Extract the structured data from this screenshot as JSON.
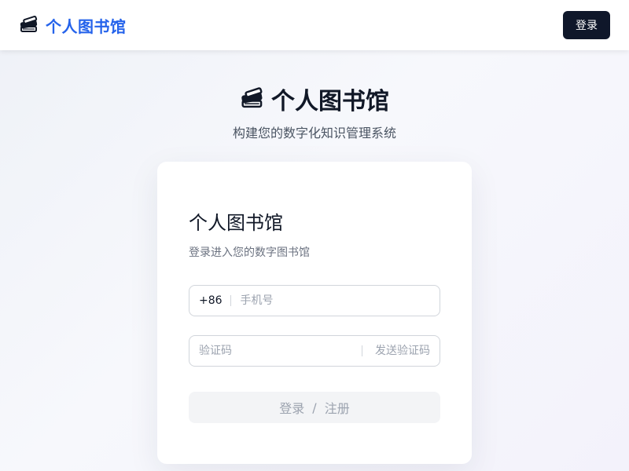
{
  "colors": {
    "brand": "#2563eb",
    "primary_button_bg": "#0f172a",
    "disabled_button_bg": "#f3f4f6"
  },
  "header": {
    "icon": "books-icon",
    "brand_name": "个人图书馆",
    "login_button": "登录"
  },
  "hero": {
    "icon": "books-icon",
    "title": "个人图书馆",
    "subtitle": "构建您的数字化知识管理系统"
  },
  "login_card": {
    "title": "个人图书馆",
    "subtitle": "登录进入您的数字图书馆",
    "phone": {
      "prefix": "+86",
      "placeholder": "手机号",
      "value": ""
    },
    "code": {
      "placeholder": "验证码",
      "value": "",
      "send_label": "发送验证码"
    },
    "submit": {
      "login": "登录",
      "separator": "/",
      "register": "注册"
    }
  }
}
